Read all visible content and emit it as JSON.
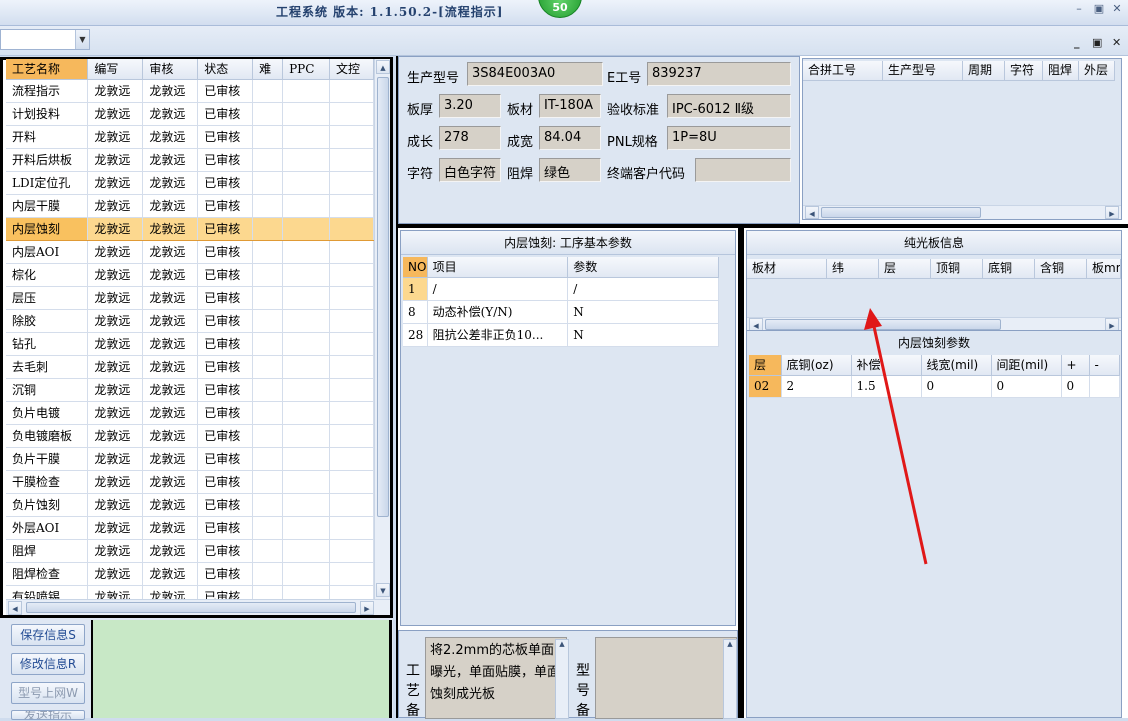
{
  "window": {
    "title": "工程系统 版本: 1.1.50.2-[流程指示]",
    "badge": "50"
  },
  "left_grid": {
    "columns": [
      "工艺名称",
      "编写",
      "审核",
      "状态",
      "难",
      "PPC",
      "文控"
    ],
    "current_row": 6,
    "rows": [
      [
        "流程指示",
        "龙敦远",
        "龙敦远",
        "已审核"
      ],
      [
        "计划投料",
        "龙敦远",
        "龙敦远",
        "已审核"
      ],
      [
        "开料",
        "龙敦远",
        "龙敦远",
        "已审核"
      ],
      [
        "开料后烘板",
        "龙敦远",
        "龙敦远",
        "已审核"
      ],
      [
        "LDI定位孔",
        "龙敦远",
        "龙敦远",
        "已审核"
      ],
      [
        "内层干膜",
        "龙敦远",
        "龙敦远",
        "已审核"
      ],
      [
        "内层蚀刻",
        "龙敦远",
        "龙敦远",
        "已审核"
      ],
      [
        "内层AOI",
        "龙敦远",
        "龙敦远",
        "已审核"
      ],
      [
        "棕化",
        "龙敦远",
        "龙敦远",
        "已审核"
      ],
      [
        "层压",
        "龙敦远",
        "龙敦远",
        "已审核"
      ],
      [
        "除胶",
        "龙敦远",
        "龙敦远",
        "已审核"
      ],
      [
        "钻孔",
        "龙敦远",
        "龙敦远",
        "已审核"
      ],
      [
        "去毛刺",
        "龙敦远",
        "龙敦远",
        "已审核"
      ],
      [
        "沉铜",
        "龙敦远",
        "龙敦远",
        "已审核"
      ],
      [
        "负片电镀",
        "龙敦远",
        "龙敦远",
        "已审核"
      ],
      [
        "负电镀磨板",
        "龙敦远",
        "龙敦远",
        "已审核"
      ],
      [
        "负片干膜",
        "龙敦远",
        "龙敦远",
        "已审核"
      ],
      [
        "干膜检查",
        "龙敦远",
        "龙敦远",
        "已审核"
      ],
      [
        "负片蚀刻",
        "龙敦远",
        "龙敦远",
        "已审核"
      ],
      [
        "外层AOI",
        "龙敦远",
        "龙敦远",
        "已审核"
      ],
      [
        "阻焊",
        "龙敦远",
        "龙敦远",
        "已审核"
      ],
      [
        "阻焊检查",
        "龙敦远",
        "龙敦远",
        "已审核"
      ],
      [
        "有铅喷锡",
        "龙敦远",
        "龙敦远",
        "已审核"
      ]
    ]
  },
  "actions": {
    "save": "保存信息S",
    "modify": "修改信息R",
    "upload": "型号上网W",
    "send": "发送指示"
  },
  "info": {
    "model_label": "生产型号",
    "model_value": "3S84E003A0",
    "e_label": "E工号",
    "e_value": "839237",
    "thick_label": "板厚",
    "thick_value": "3.20",
    "material_label": "板材",
    "material_value": "IT-180A",
    "std_label": "验收标准",
    "std_value": "IPC-6012 Ⅱ级",
    "length_label": "成长",
    "length_value": "278",
    "width_label": "成宽",
    "width_value": "84.04",
    "pnl_label": "PNL规格",
    "pnl_value": "1P=8U",
    "char_label": "字符",
    "char_value": "白色字符",
    "mask_label": "阻焊",
    "mask_value": "绿色",
    "cust_label": "终端客户代码",
    "cust_value": ""
  },
  "merge_grid": {
    "columns": [
      "合拼工号",
      "生产型号",
      "周期",
      "字符",
      "阻焊",
      "外层"
    ]
  },
  "process_params": {
    "title": "内层蚀刻: 工序基本参数",
    "columns": [
      "NO",
      "项目",
      "参数"
    ],
    "rows": [
      [
        "1",
        "/",
        "/"
      ],
      [
        "8",
        "动态补偿(Y/N)",
        "N"
      ],
      [
        "28",
        "阻抗公差非正负10...",
        "N"
      ]
    ]
  },
  "light_board": {
    "title": "纯光板信息",
    "columns": [
      "板材",
      "纬",
      "层",
      "顶铜",
      "底铜",
      "含铜",
      "板mm"
    ]
  },
  "etch_params": {
    "title": "内层蚀刻参数",
    "columns": [
      "层",
      "底铜(oz)",
      "补偿",
      "线宽(mil)",
      "间距(mil)",
      "+",
      "-"
    ],
    "rows": [
      [
        "02",
        "2",
        "1.5",
        "0",
        "0",
        "0",
        ""
      ]
    ]
  },
  "remarks": {
    "process_label": "工艺备",
    "process_text": "将2.2mm的芯板单面曝光，单面贴膜，单面蚀刻成光板",
    "model_label": "型号备"
  },
  "colors": {
    "accent_orange": "#f6b85c",
    "selected_row": "#fcd88f",
    "panel_bg": "#dde6f2",
    "annotation_arrow": "#e01818"
  }
}
